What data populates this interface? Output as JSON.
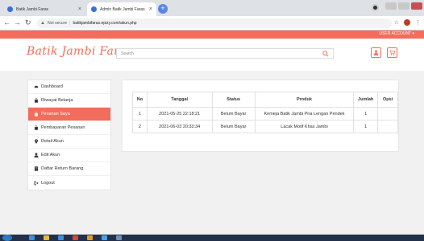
{
  "browser": {
    "tabs": [
      {
        "title": "Batik Jambi Faras"
      },
      {
        "title": "Admin Batik Jambi Faras"
      }
    ],
    "address": {
      "security_label": "Not secure",
      "url": "batikjambifaras.epizy.com/akun.php"
    }
  },
  "site": {
    "user_account_label": "USER ACCOUNT",
    "logo_text": "Batik Jambi Faras",
    "search_placeholder": "Search",
    "accent_color": "#f26d5b"
  },
  "sidebar": {
    "items": [
      {
        "label": "Dashboard",
        "icon": "dashboard-icon",
        "active": false
      },
      {
        "label": "Riwayat Belanja",
        "icon": "shopping-bag-icon",
        "active": false
      },
      {
        "label": "Pesanan Saya",
        "icon": "shopping-bag-icon",
        "active": true
      },
      {
        "label": "Pembayaran Pesanan",
        "icon": "shopping-bag-icon",
        "active": false
      },
      {
        "label": "Detail Akun",
        "icon": "map-pin-icon",
        "active": false
      },
      {
        "label": "Edit Akun",
        "icon": "user-icon",
        "active": false
      },
      {
        "label": "Daftar Return Barang",
        "icon": "document-icon",
        "active": false
      },
      {
        "label": "Logout",
        "icon": "logout-icon",
        "active": false
      }
    ]
  },
  "orders": {
    "columns": [
      "No",
      "Tanggal",
      "Status",
      "Produk",
      "Jumlah",
      "Opsi"
    ],
    "rows": [
      {
        "no": "1",
        "tanggal": "2021-05-25 22:18:21",
        "status": "Belum Bayar",
        "produk": "Kemeja Batik Jambi Pria Lengan Pendek",
        "jumlah": "1",
        "opsi": ""
      },
      {
        "no": "2",
        "tanggal": "2021-06-03 20:33:34",
        "status": "Belum Bayar",
        "produk": "Lacak Motif Khas Jambi",
        "jumlah": "1",
        "opsi": ""
      }
    ]
  }
}
